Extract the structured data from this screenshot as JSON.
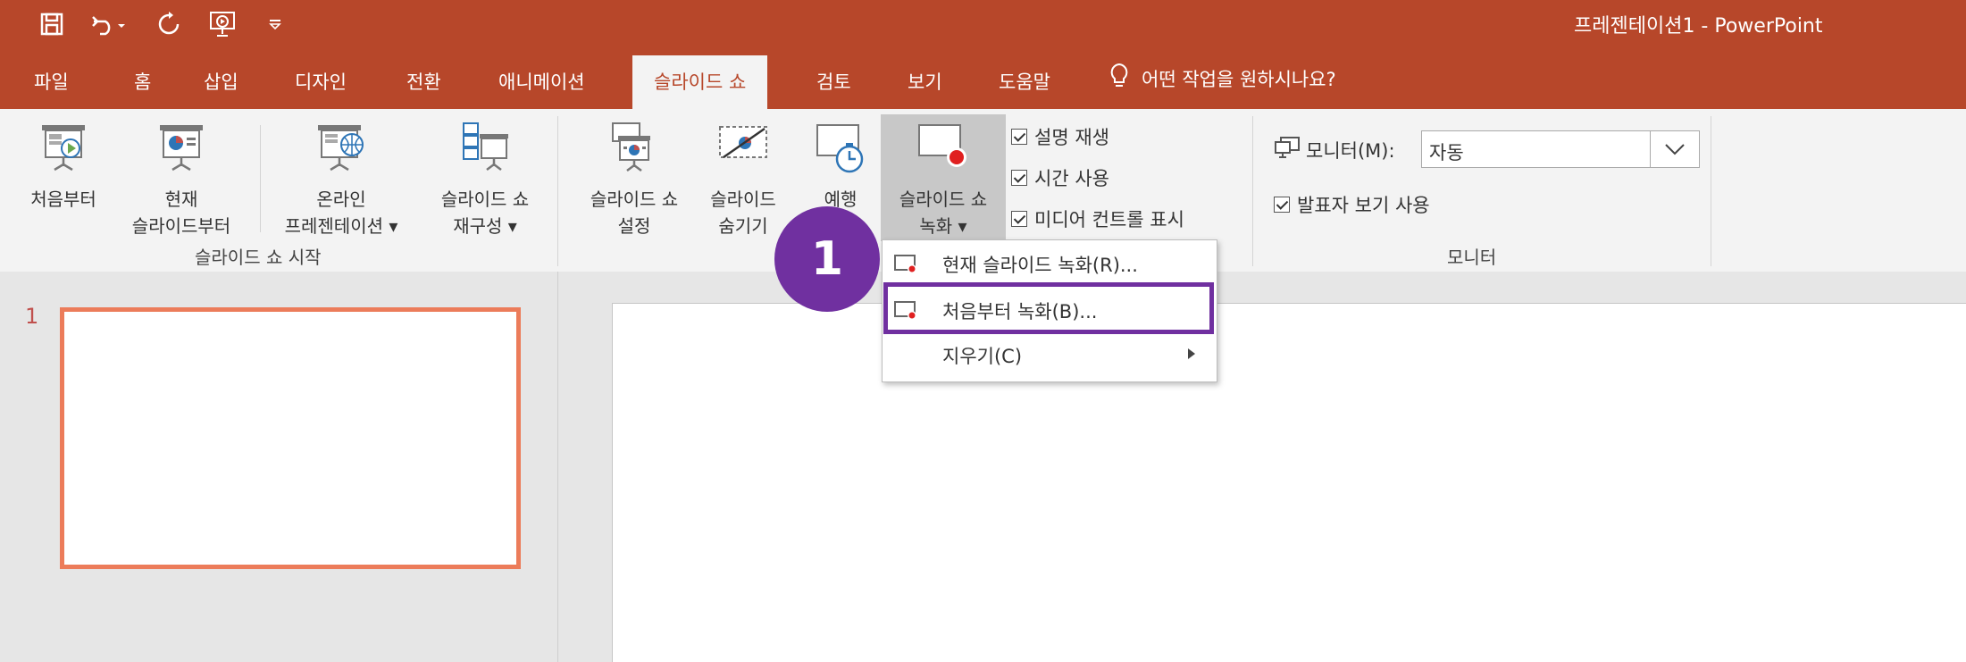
{
  "window": {
    "title": "프레젠테이션1  -  PowerPoint",
    "accent": "#b7472a"
  },
  "qat": {
    "icons": [
      "save-icon",
      "undo-icon",
      "redo-icon",
      "start-from-beginning-icon",
      "customize-qat-icon"
    ]
  },
  "tabs": [
    "파일",
    "홈",
    "삽입",
    "디자인",
    "전환",
    "애니메이션",
    "슬라이드 쇼",
    "검토",
    "보기",
    "도움말"
  ],
  "active_tab": "슬라이드 쇼",
  "tell_me": {
    "text": "어떤 작업을 원하시나요?",
    "icon": "lightbulb-icon"
  },
  "ribbon": {
    "start_group": {
      "label": "슬라이드 쇼 시작",
      "from_beginning": [
        "처음부터"
      ],
      "from_current": [
        "현재",
        "슬라이드부터"
      ],
      "online": [
        "온라인",
        "프레젠테이션 ▾"
      ],
      "custom": [
        "슬라이드 쇼",
        "재구성 ▾"
      ]
    },
    "setup_group": {
      "setup": [
        "슬라이드 쇼",
        "설정"
      ],
      "hide": [
        "슬라이드",
        "숨기기"
      ],
      "rehearse": [
        "예행"
      ],
      "record": [
        "슬라이드 쇼",
        "녹화 ▾"
      ],
      "checks": [
        "설명 재생",
        "시간 사용",
        "미디어 컨트롤 표시"
      ]
    },
    "monitor_group": {
      "label": "모니터",
      "monitor_label": "모니터(M):",
      "monitor_value": "자동",
      "presenter_view": "발표자 보기 사용"
    }
  },
  "record_menu": {
    "items": [
      {
        "label": "현재 슬라이드 녹화(R)..."
      },
      {
        "label": "처음부터 녹화(B)..."
      },
      {
        "label": "지우기(C)"
      }
    ]
  },
  "slides": {
    "first_number": "1"
  },
  "annotation": {
    "step": "1",
    "color": "#7030a0"
  }
}
